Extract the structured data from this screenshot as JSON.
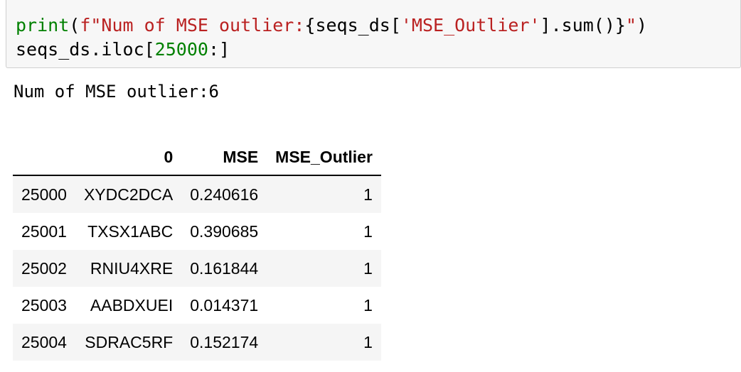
{
  "input_cell": {
    "line1": {
      "fn": "print",
      "p1": "(",
      "fprefix": "f\"Num of MSE outlier:",
      "p2": "{seqs_ds[",
      "key": "'MSE_Outlier'",
      "p3": "].sum()}",
      "fclose": "\"",
      "p4": ")"
    },
    "line2": {
      "p1": "seqs_ds.iloc[",
      "num": "25000",
      "p2": ":]"
    }
  },
  "output": {
    "text": "Num of MSE outlier:6",
    "table": {
      "columns": [
        "",
        "0",
        "MSE",
        "MSE_Outlier"
      ],
      "rows": [
        {
          "index": "25000",
          "c0": "XYDC2DCA",
          "mse": "0.240616",
          "outlier": "1"
        },
        {
          "index": "25001",
          "c0": "TXSX1ABC",
          "mse": "0.390685",
          "outlier": "1"
        },
        {
          "index": "25002",
          "c0": "RNIU4XRE",
          "mse": "0.161844",
          "outlier": "1"
        },
        {
          "index": "25003",
          "c0": "AABDXUEI",
          "mse": "0.014371",
          "outlier": "1"
        },
        {
          "index": "25004",
          "c0": "SDRAC5RF",
          "mse": "0.152174",
          "outlier": "1"
        }
      ]
    }
  }
}
